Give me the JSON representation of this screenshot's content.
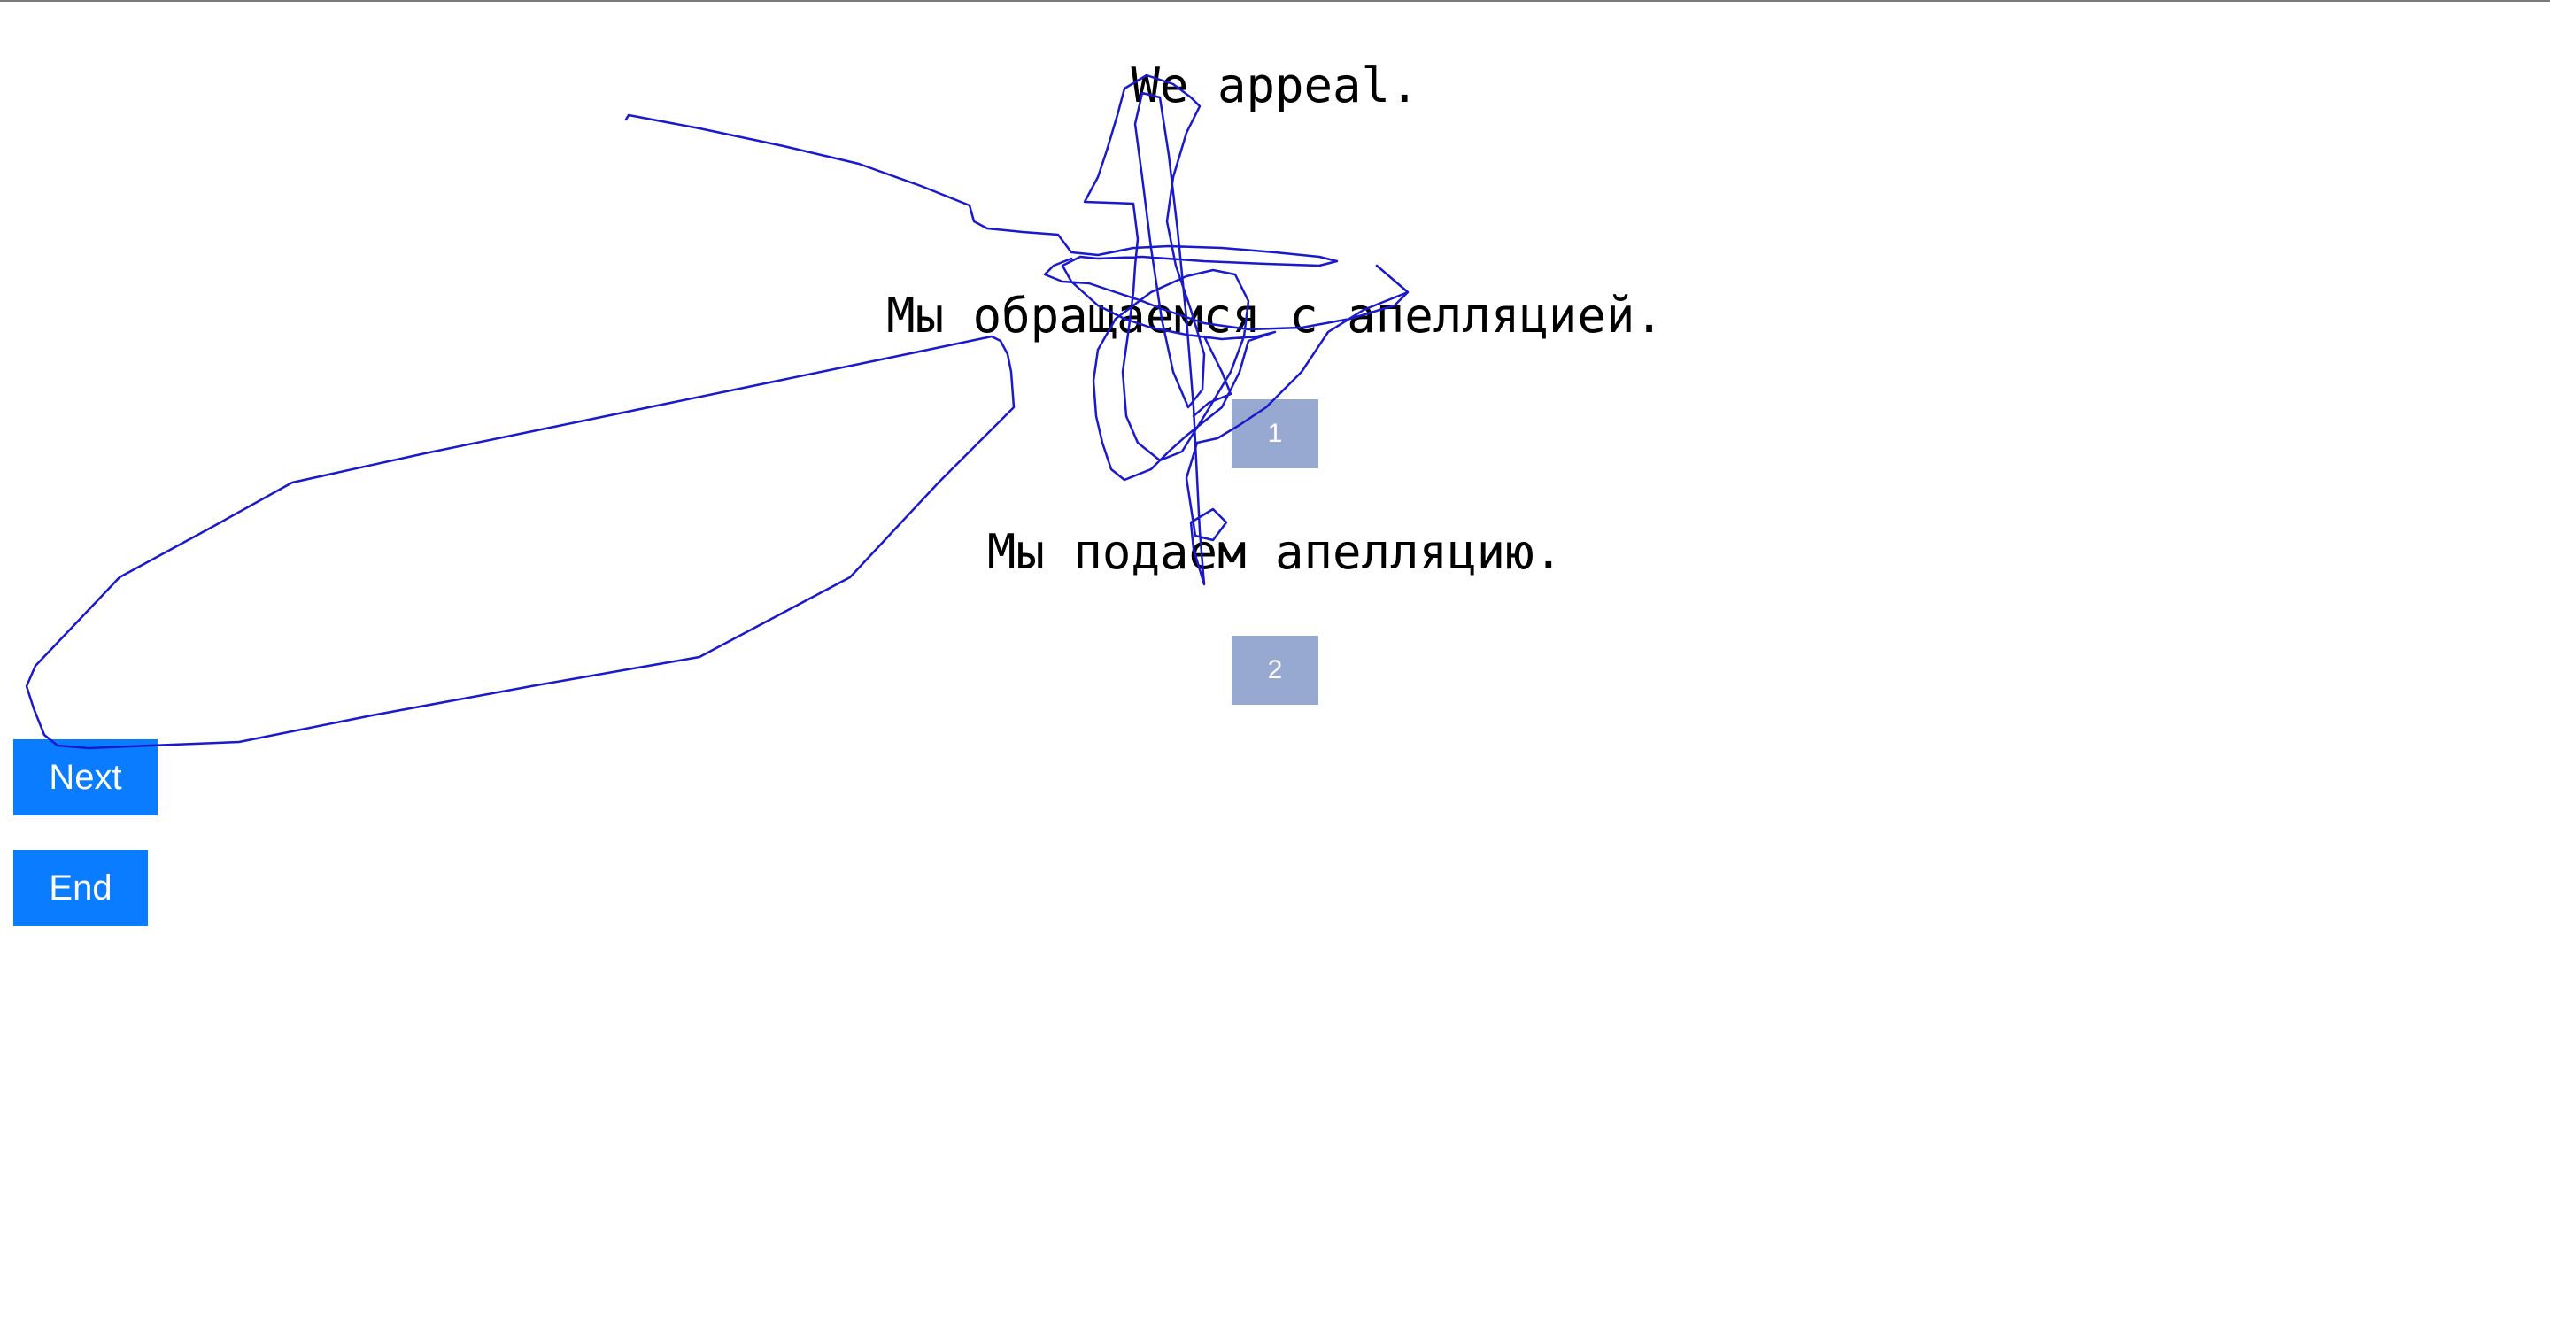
{
  "prompt": {
    "text": "We appeal."
  },
  "options": [
    {
      "text": "Мы обращаемся с апелляцией.",
      "button_label": "1"
    },
    {
      "text": "Мы подаем апелляцию.",
      "button_label": "2"
    }
  ],
  "actions": {
    "next_label": "Next",
    "end_label": "End"
  },
  "colors": {
    "choice_button": "#97a9d1",
    "action_button": "#0a7cff",
    "trace_line": "#1a1acc"
  }
}
